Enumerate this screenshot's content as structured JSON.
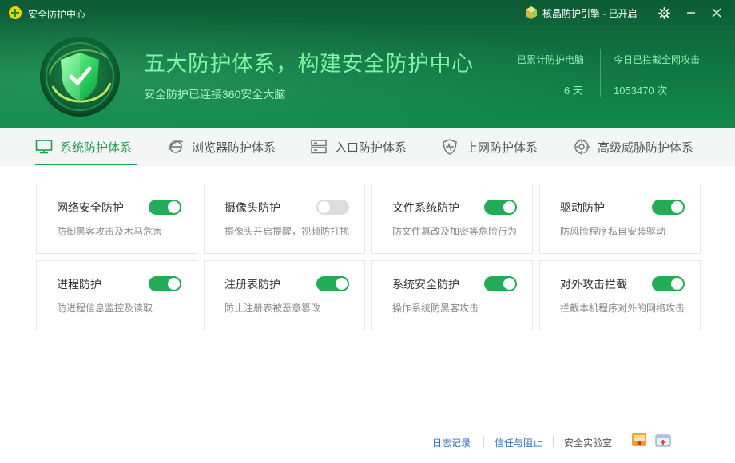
{
  "window": {
    "title": "安全防护中心",
    "engine_status": "核晶防护引擎 - 已开启"
  },
  "hero": {
    "title": "五大防护体系，构建安全防护中心",
    "subtitle": "安全防护已连接360安全大脑",
    "stats": [
      {
        "label": "已累计防护电脑",
        "value": "6 天"
      },
      {
        "label": "今日已拦截全网攻击",
        "value": "1053470 次"
      }
    ]
  },
  "tabs": [
    {
      "label": "系统防护体系",
      "icon": "monitor-icon",
      "active": true
    },
    {
      "label": "浏览器防护体系",
      "icon": "browser-icon",
      "active": false
    },
    {
      "label": "入口防护体系",
      "icon": "server-icon",
      "active": false
    },
    {
      "label": "上网防护体系",
      "icon": "shield-pulse-icon",
      "active": false
    },
    {
      "label": "高级威胁防护体系",
      "icon": "crosshair-icon",
      "active": false
    }
  ],
  "cards": [
    {
      "title": "网络安全防护",
      "desc": "防御黑客攻击及木马危害",
      "enabled": true
    },
    {
      "title": "摄像头防护",
      "desc": "摄像头开启提醒，视频防打扰",
      "enabled": false
    },
    {
      "title": "文件系统防护",
      "desc": "防文件篡改及加密等危险行为",
      "enabled": true
    },
    {
      "title": "驱动防护",
      "desc": "防风险程序私自安装驱动",
      "enabled": true
    },
    {
      "title": "进程防护",
      "desc": "防进程信息监控及读取",
      "enabled": true
    },
    {
      "title": "注册表防护",
      "desc": "防止注册表被恶意篡改",
      "enabled": true
    },
    {
      "title": "系统安全防护",
      "desc": "操作系统防黑客攻击",
      "enabled": true
    },
    {
      "title": "对外攻击拦截",
      "desc": "拦截本机程序对外的网络攻击",
      "enabled": true
    }
  ],
  "footer": {
    "log_link": "日志记录",
    "trust_link": "信任与阻止",
    "lab_label": "安全实验室"
  },
  "colors": {
    "header_green": "#0f6d3f",
    "accent_green": "#1aa251",
    "toggle_on": "#22ac55",
    "toggle_off": "#dddddd",
    "link_blue": "#2f6fbf"
  }
}
